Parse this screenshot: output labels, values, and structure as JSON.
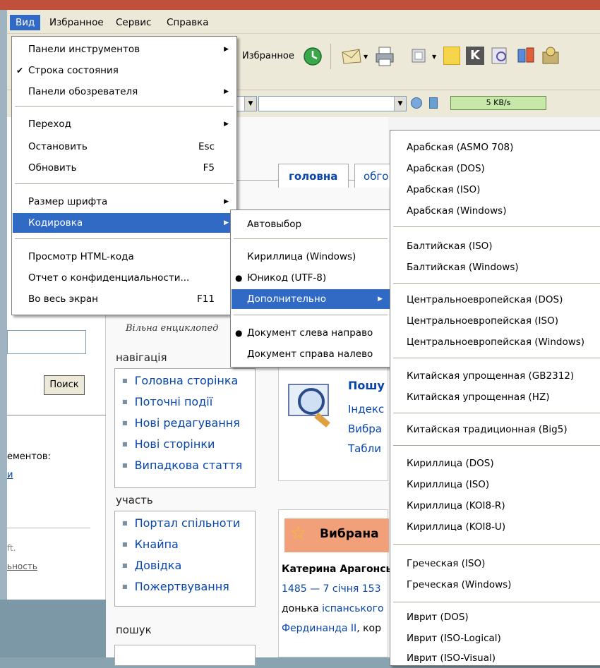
{
  "menubar": {
    "items": [
      "Вид",
      "Избранное",
      "Сервис",
      "Справка"
    ]
  },
  "toolbar": {
    "favorites_label": "Избранное",
    "speed": "5 KB/s"
  },
  "view_menu": {
    "toolbars": "Панели инструментов",
    "status_bar": "Строка состояния",
    "explorer_bars": "Панели обозревателя",
    "go_to": "Переход",
    "stop": "Остановить",
    "stop_key": "Esc",
    "refresh": "Обновить",
    "refresh_key": "F5",
    "text_size": "Размер шрифта",
    "encoding": "Кодировка",
    "source": "Просмотр HTML-кода",
    "privacy": "Отчет о конфиденциальности...",
    "fullscreen": "Во весь экран",
    "fullscreen_key": "F11"
  },
  "encoding_menu": {
    "auto": "Автовыбор",
    "cyrillic_windows": "Кириллица (Windows)",
    "unicode": "Юникод (UTF-8)",
    "more": "Дополнительно",
    "ltr": "Документ слева направо",
    "rtl": "Документ справа налево"
  },
  "more_menu": {
    "items": [
      "Арабская (ASMO 708)",
      "Арабская (DOS)",
      "Арабская (ISO)",
      "Арабская (Windows)",
      "Балтийская (ISO)",
      "Балтийская (Windows)",
      "Центральноевропейская (DOS)",
      "Центральноевропейская (ISO)",
      "Центральноевропейская (Windows)",
      "Китайская упрощенная (GB2312)",
      "Китайская упрощенная (HZ)",
      "Китайская традиционная (Big5)",
      "Кириллица (DOS)",
      "Кириллица (ISO)",
      "Кириллица (KOI8-R)",
      "Кириллица (KOI8-U)",
      "Греческая (ISO)",
      "Греческая (Windows)",
      "Иврит (DOS)",
      "Иврит (ISO-Logical)",
      "Иврит (ISO-Visual)"
    ]
  },
  "left_pane": {
    "search_button": "Поиск",
    "elements_text": "ементов:",
    "link_fragment": "и",
    "ms_text": "ft.",
    "privacy_link": "ьность"
  },
  "wiki": {
    "tab_main": "головна",
    "tab_discussion": "обго",
    "tagline": "Вільна енциклопед",
    "nav_heading": "навігація",
    "nav_items": [
      "Головна сторінка",
      "Поточні події",
      "Нові редагування",
      "Нові сторінки",
      "Випадкова стаття"
    ],
    "participate_heading": "участь",
    "participate_items": [
      "Портал спільноти",
      "Кнайпа",
      "Довідка",
      "Пожертвування"
    ],
    "search_heading": "пошук",
    "search_title": "Пошу",
    "search_links": [
      "Індекс",
      "Вибра",
      "Табли"
    ],
    "featured_title": "Вибрана",
    "article_name": "Катерина Арагонсь",
    "article_dates": "1485 — 7 січня 153",
    "article_line3a": "донька ",
    "article_line3b": "іспанського",
    "article_line4a": "Фердинанда ІІ",
    "article_line4b": ", кор"
  }
}
